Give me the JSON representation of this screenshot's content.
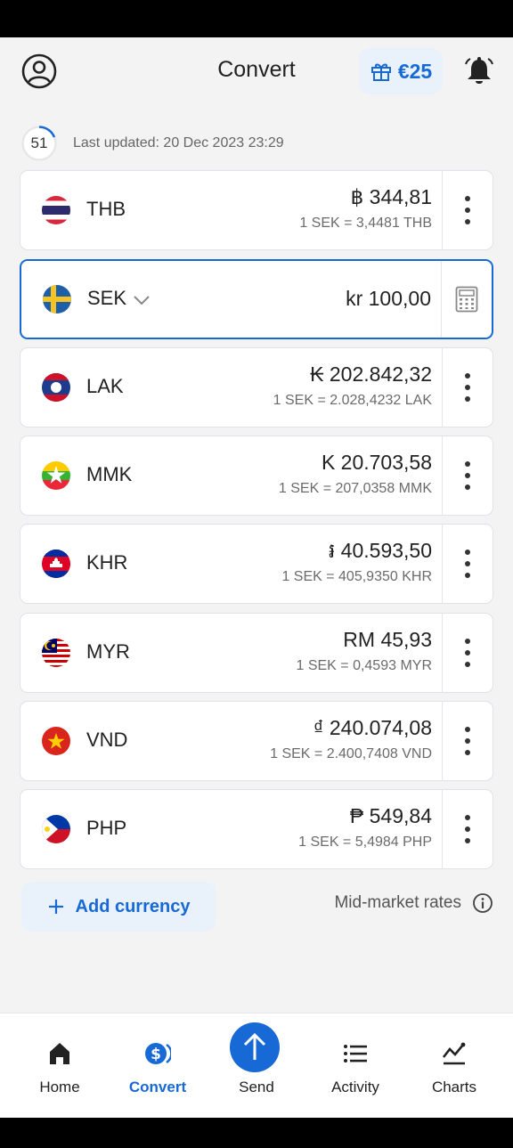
{
  "header": {
    "title": "Convert",
    "reward_label": "€25"
  },
  "update": {
    "counter": "51",
    "text": "Last updated: 20 Dec 2023 23:29"
  },
  "currencies": [
    {
      "code": "THB",
      "amount": "฿ 344,81",
      "rate": "1 SEK = 3,4481 THB"
    },
    {
      "code": "SEK",
      "amount": "kr 100,00",
      "rate": ""
    },
    {
      "code": "LAK",
      "amount": "₭ 202.842,32",
      "rate": "1 SEK = 2.028,4232 LAK"
    },
    {
      "code": "MMK",
      "amount": "K 20.703,58",
      "rate": "1 SEK = 207,0358 MMK"
    },
    {
      "code": "KHR",
      "amount": "៛ 40.593,50",
      "rate": "1 SEK = 405,9350 KHR"
    },
    {
      "code": "MYR",
      "amount": "RM 45,93",
      "rate": "1 SEK = 0,4593 MYR"
    },
    {
      "code": "VND",
      "amount": "₫ 240.074,08",
      "rate": "1 SEK = 2.400,7408 VND"
    },
    {
      "code": "PHP",
      "amount": "₱ 549,84",
      "rate": "1 SEK = 5,4984 PHP"
    }
  ],
  "actions": {
    "add_currency": "Add currency",
    "mid_market": "Mid-market rates"
  },
  "tabs": [
    {
      "label": "Home"
    },
    {
      "label": "Convert"
    },
    {
      "label": "Send"
    },
    {
      "label": "Activity"
    },
    {
      "label": "Charts"
    }
  ],
  "colors": {
    "accent": "#1769d6"
  }
}
